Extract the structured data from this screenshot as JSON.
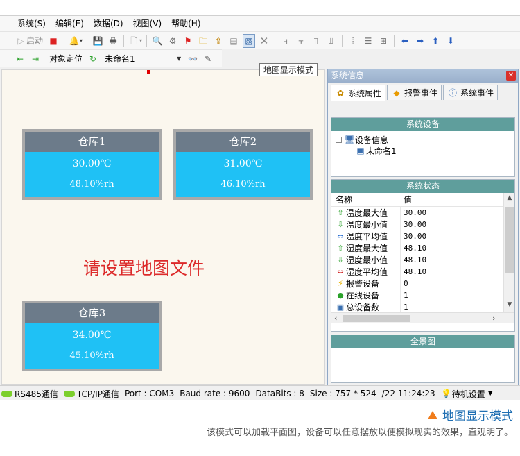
{
  "menu": [
    "系统(S)",
    "编辑(E)",
    "数据(D)",
    "视图(V)",
    "帮助(H)"
  ],
  "toolbar1": {
    "start_label": "启动",
    "icons": [
      "play-icon",
      "stop-icon",
      "alarm-icon",
      "save-icon",
      "print-icon",
      "new-doc-icon",
      "zoom-icon",
      "settings-icon",
      "flag-icon",
      "folder-icon",
      "import-icon",
      "list-icon",
      "map-mode-icon",
      "delete-icon",
      "align-left-icon",
      "align-right-icon",
      "align-top-icon",
      "align-bottom-icon",
      "distribute-h-icon",
      "distribute-v-icon",
      "grid-icon",
      "arrow-left-icon",
      "arrow-right-icon",
      "arrow-up-icon",
      "arrow-down-icon"
    ]
  },
  "toolbar2": {
    "locate_label": "对象定位",
    "combo_value": "未命名1"
  },
  "tooltip": "地图显示模式",
  "map": {
    "hint": "请设置地图文件",
    "warehouses": [
      {
        "name": "仓库1",
        "temp": "30.00℃",
        "humidity": "48.10%rh"
      },
      {
        "name": "仓库2",
        "temp": "31.00℃",
        "humidity": "46.10%rh"
      },
      {
        "name": "仓库3",
        "temp": "34.00℃",
        "humidity": "45.10%rh"
      }
    ]
  },
  "panel": {
    "title": "系统信息",
    "tabs": [
      "系统属性",
      "报警事件",
      "系统事件"
    ],
    "devices_title": "系统设备",
    "tree_root": "设备信息",
    "tree_child": "未命名1",
    "status_title": "系统状态",
    "col_name": "名称",
    "col_value": "值",
    "rows": [
      {
        "name": "温度最大值",
        "value": "30.00",
        "icon": "up-arrow-icon",
        "color": "#2aa12a",
        "glyph": "⇧"
      },
      {
        "name": "温度最小值",
        "value": "30.00",
        "icon": "down-arrow-icon",
        "color": "#2aa12a",
        "glyph": "⇩"
      },
      {
        "name": "温度平均值",
        "value": "30.00",
        "icon": "lr-arrow-icon",
        "color": "#2a6fd1",
        "glyph": "⇔"
      },
      {
        "name": "湿度最大值",
        "value": "48.10",
        "icon": "up-arrow-icon",
        "color": "#2aa12a",
        "glyph": "⇧"
      },
      {
        "name": "湿度最小值",
        "value": "48.10",
        "icon": "down-arrow-icon",
        "color": "#2aa12a",
        "glyph": "⇩"
      },
      {
        "name": "湿度平均值",
        "value": "48.10",
        "icon": "lr-arrow-icon",
        "color": "#d12a2a",
        "glyph": "⇔"
      },
      {
        "name": "报警设备",
        "value": "0",
        "icon": "lightning-icon",
        "color": "#e8b400",
        "glyph": "⚡"
      },
      {
        "name": "在线设备",
        "value": "1",
        "icon": "online-dot-icon",
        "color": "#2aa12a",
        "glyph": "●"
      },
      {
        "name": "总设备数",
        "value": "1",
        "icon": "monitor-icon",
        "color": "#3a6fb0",
        "glyph": "▣"
      }
    ],
    "panorama_title": "全景图"
  },
  "statusbar": {
    "rs485": "RS485通信",
    "tcp": "TCP/IP通信",
    "port": "Port : COM3",
    "baud": "Baud rate  : 9600",
    "databits": "DataBits : 8",
    "size": "Size : 757 * 524",
    "time": "/22 11:24:23",
    "standby": "待机设置"
  },
  "caption": {
    "title": "地图显示模式",
    "text": "该模式可以加载平面图，设备可以任意摆放以便模拟现实的效果，直观明了。"
  },
  "colors": {
    "accent": "#1f6fb3",
    "warehouse_body": "#1fc1f5",
    "warehouse_head": "#6c7b8a",
    "hint": "#dc2a2a",
    "section_title": "#5f9e9c"
  }
}
